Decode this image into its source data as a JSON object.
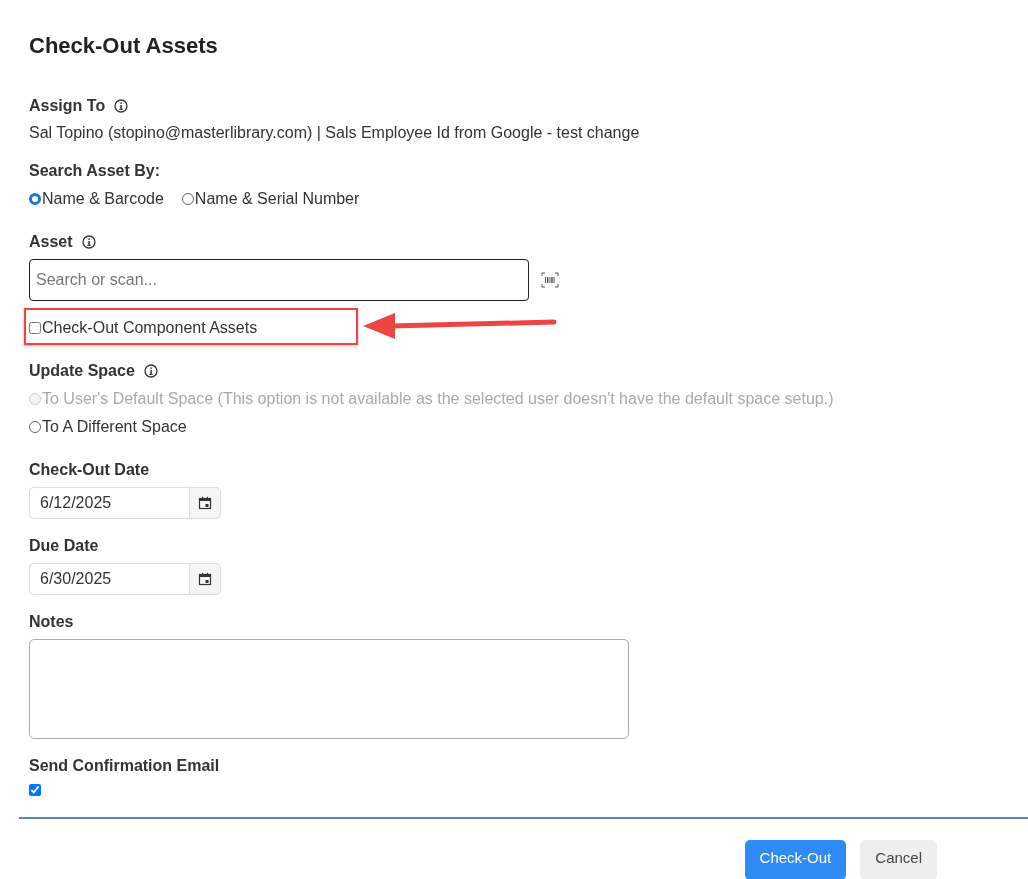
{
  "title": "Check-Out Assets",
  "assign_to": {
    "label": "Assign To",
    "value": "Sal Topino (stopino@masterlibrary.com) | Sals Employee Id from Google - test change"
  },
  "search_by": {
    "label": "Search Asset By:",
    "options": [
      {
        "label": "Name & Barcode",
        "selected": true
      },
      {
        "label": "Name & Serial Number",
        "selected": false
      }
    ]
  },
  "asset": {
    "label": "Asset",
    "placeholder": "Search or scan..."
  },
  "component_assets": {
    "label": "Check-Out Component Assets",
    "checked": false,
    "highlighted": true
  },
  "update_space": {
    "label": "Update Space",
    "options": [
      {
        "label": "To User's Default Space (This option is not available as the selected user doesn't have the default space setup.)",
        "selected": false,
        "disabled": true
      },
      {
        "label": "To A Different Space",
        "selected": false,
        "disabled": false
      }
    ]
  },
  "checkout_date": {
    "label": "Check-Out Date",
    "value": "6/12/2025"
  },
  "due_date": {
    "label": "Due Date",
    "value": "6/30/2025"
  },
  "notes": {
    "label": "Notes"
  },
  "send_email": {
    "label": "Send Confirmation Email",
    "checked": true
  },
  "buttons": [
    {
      "label": "Check-Out",
      "kind": "primary"
    },
    {
      "label": "Cancel",
      "kind": "secondary"
    }
  ]
}
